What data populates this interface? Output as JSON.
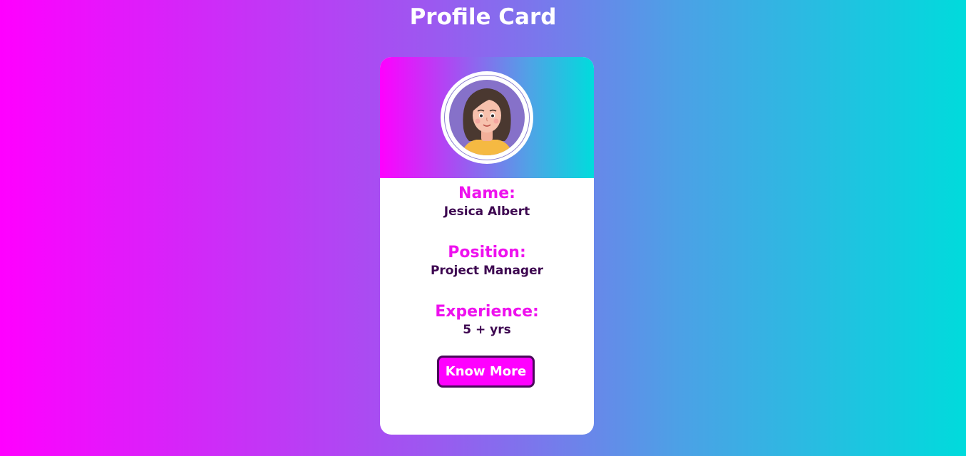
{
  "page": {
    "title": "Profile Card"
  },
  "card": {
    "avatar_icon": "woman-avatar-icon",
    "fields": [
      {
        "label": "Name:",
        "value": "Jesica Albert"
      },
      {
        "label": "Position:",
        "value": "Project Manager"
      },
      {
        "label": "Experience:",
        "value": "5 + yrs"
      }
    ],
    "button_label": "Know More"
  },
  "colors": {
    "accent": "#ff00ff",
    "secondary": "#00dcdc",
    "label_text": "#ee11ee",
    "value_text": "#3d0650",
    "button_border": "#4a0a5a"
  }
}
